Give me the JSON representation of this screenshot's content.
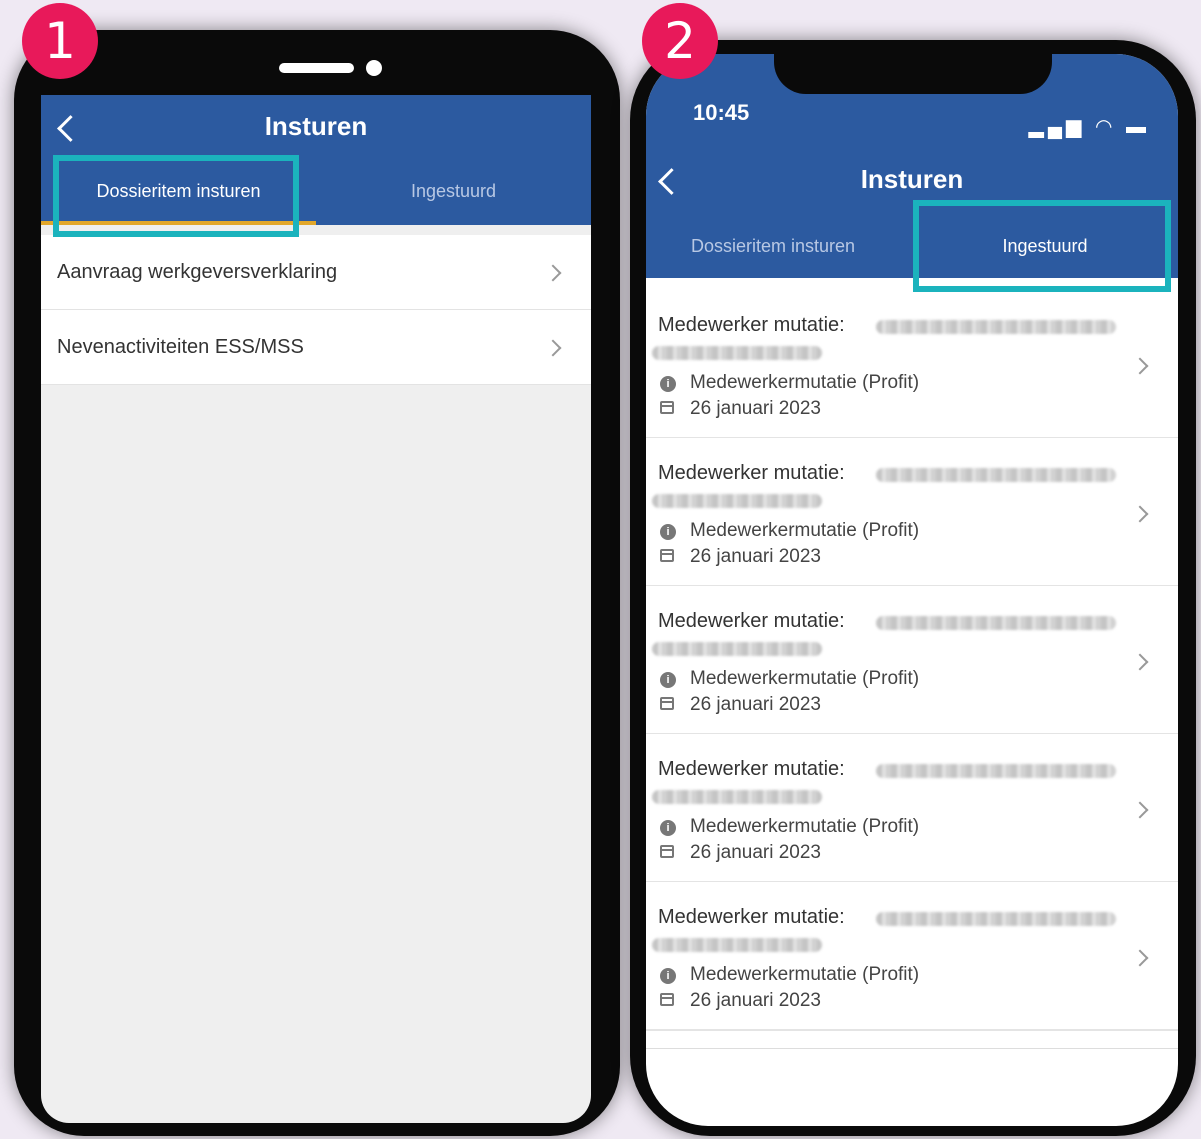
{
  "badges": [
    "1",
    "2"
  ],
  "phone1": {
    "title": "Insturen",
    "tabs": [
      {
        "label": "Dossieritem insturen",
        "active": true
      },
      {
        "label": "Ingestuurd",
        "active": false
      }
    ],
    "items": [
      {
        "label": "Aanvraag werkgeversverklaring"
      },
      {
        "label": "Nevenactiviteiten ESS/MSS"
      }
    ]
  },
  "phone2": {
    "status_time": "10:45",
    "title": "Insturen",
    "tabs": [
      {
        "label": "Dossieritem insturen",
        "active": false
      },
      {
        "label": "Ingestuurd",
        "active": true
      }
    ],
    "items": [
      {
        "title": "Medewerker mutatie:",
        "type": "Medewerkermutatie (Profit)",
        "date": "26 januari 2023"
      },
      {
        "title": "Medewerker mutatie:",
        "type": "Medewerkermutatie (Profit)",
        "date": "26 januari 2023"
      },
      {
        "title": "Medewerker mutatie:",
        "type": "Medewerkermutatie (Profit)",
        "date": "26 januari 2023"
      },
      {
        "title": "Medewerker mutatie:",
        "type": "Medewerkermutatie (Profit)",
        "date": "26 januari 2023"
      },
      {
        "title": "Medewerker mutatie:",
        "type": "Medewerkermutatie (Profit)",
        "date": "26 januari 2023"
      }
    ]
  },
  "colors": {
    "appbar": "#2c5aa0",
    "highlight": "#1bb3bd",
    "badge": "#e8195a",
    "tab_underline": "#e2a72a"
  }
}
